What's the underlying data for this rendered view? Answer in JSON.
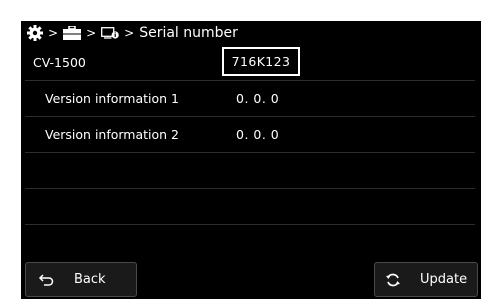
{
  "breadcrumb": {
    "separator": ">",
    "icons": [
      "gear-icon",
      "toolbox-icon",
      "device-info-icon"
    ],
    "current": "Serial number"
  },
  "device": {
    "model": "CV-1500",
    "serial": "716K123"
  },
  "rows": [
    {
      "label": "Version information 1",
      "value": "0. 0. 0"
    },
    {
      "label": "Version information 2",
      "value": "0. 0. 0"
    }
  ],
  "buttons": {
    "back": "Back",
    "update": "Update"
  },
  "colors": {
    "background": "#000000",
    "text": "#ffffff",
    "divider": "#2d2d2d",
    "button_border": "#4a4a4a"
  }
}
